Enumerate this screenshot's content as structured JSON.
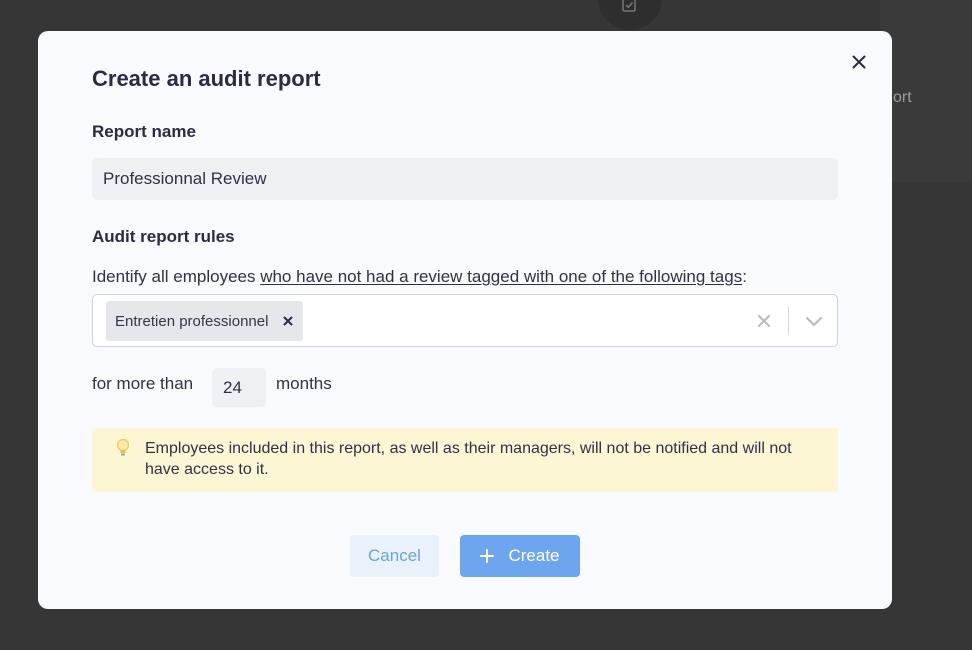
{
  "background": {
    "partial_text": "ort"
  },
  "modal": {
    "title": "Create an audit report",
    "report_name": {
      "label": "Report name",
      "value": "Professionnal Review"
    },
    "rules": {
      "label": "Audit report rules",
      "sentence_prefix": "Identify all employees ",
      "sentence_link": "who have not had a review tagged with one of the following tags",
      "sentence_suffix": ":",
      "selected_tags": [
        "Entretien professionnel"
      ],
      "period_prefix": "for more than",
      "period_value": "24",
      "period_suffix": "months"
    },
    "notice": {
      "text": "Employees included in this report, as well as their managers, will not be notified and will not have access to it."
    },
    "actions": {
      "cancel_label": "Cancel",
      "create_label": "Create"
    }
  },
  "colors": {
    "primary": "#6da6ee",
    "title": "#2a2b48",
    "notice_bg": "#fdf6d4"
  }
}
